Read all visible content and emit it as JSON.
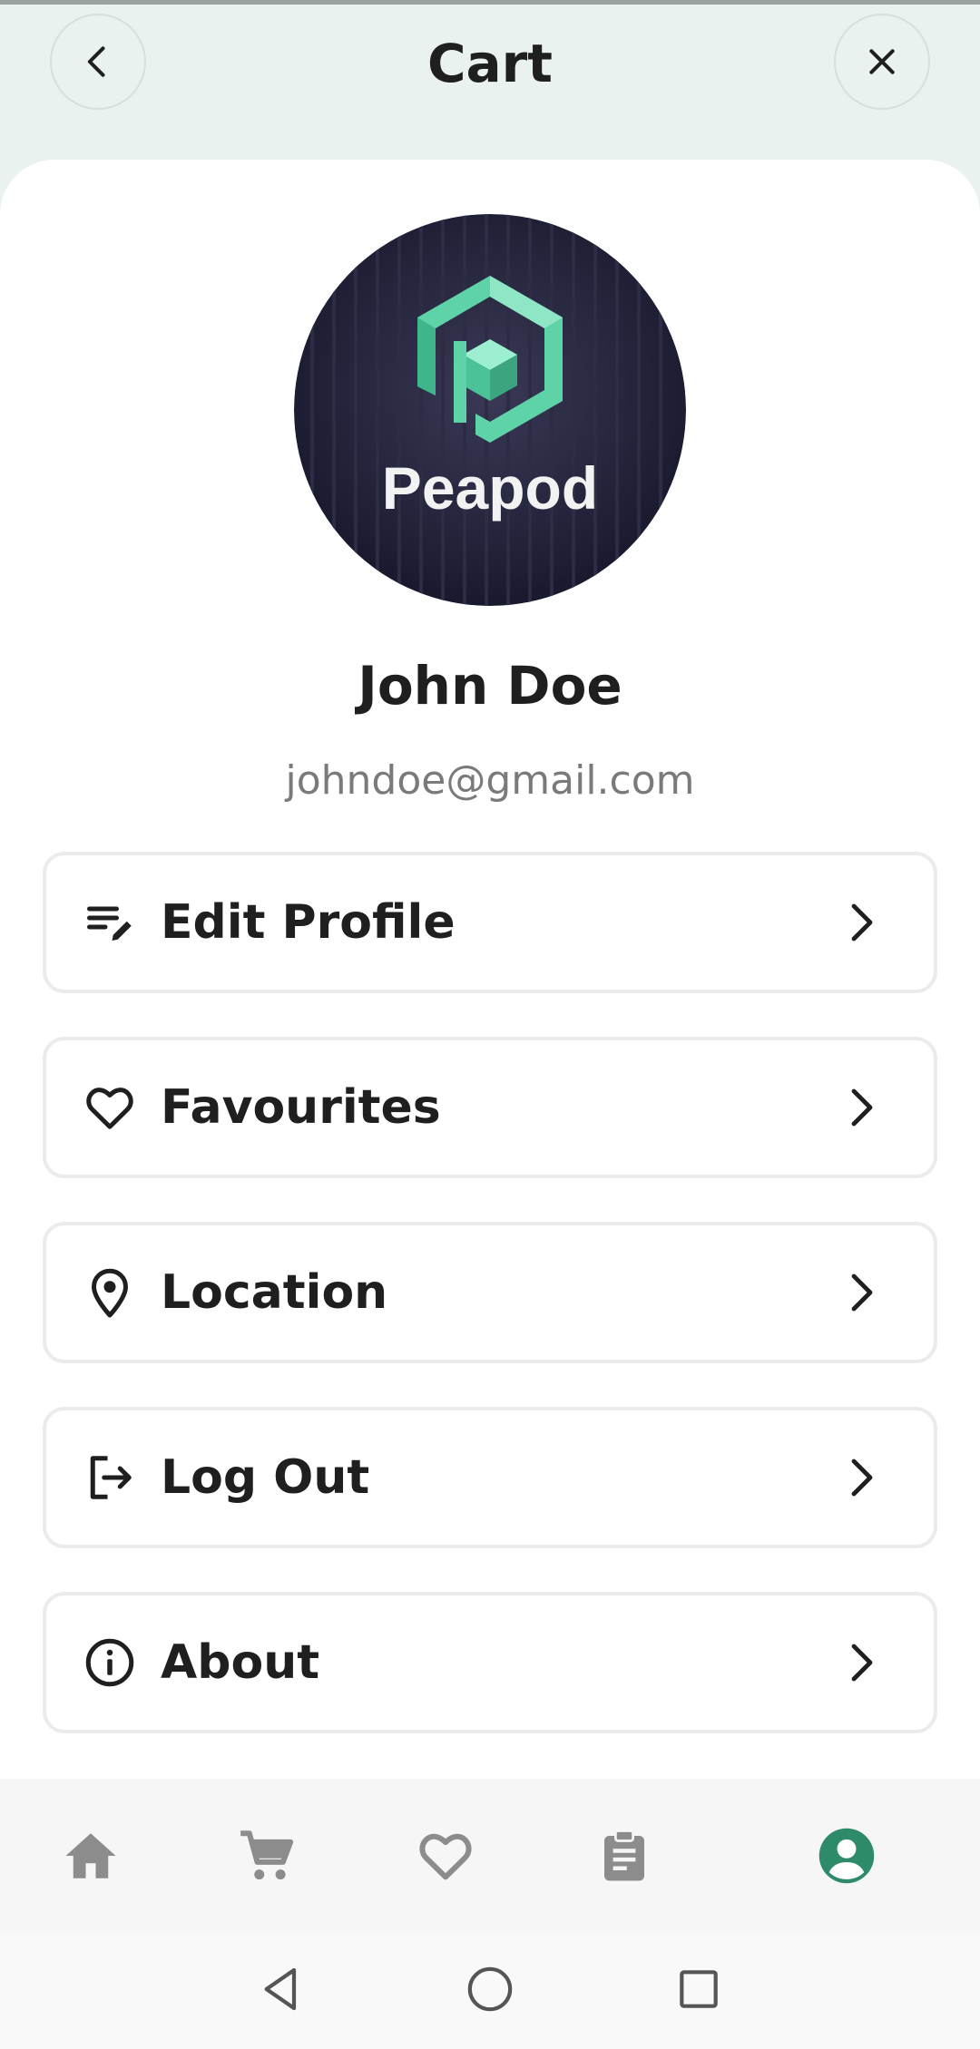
{
  "header": {
    "title": "Cart",
    "back_icon": "chevron-left-icon",
    "close_icon": "close-icon"
  },
  "profile": {
    "logo_text": "Peapod",
    "name": "John Doe",
    "email": "johndoe@gmail.com"
  },
  "menu": [
    {
      "label": "Edit Profile",
      "icon": "edit-list-icon"
    },
    {
      "label": "Favourites",
      "icon": "heart-icon"
    },
    {
      "label": "Location",
      "icon": "location-pin-icon"
    },
    {
      "label": "Log Out",
      "icon": "logout-icon"
    },
    {
      "label": "About",
      "icon": "info-icon"
    }
  ],
  "bottom_nav": {
    "items": [
      "home-icon",
      "cart-icon",
      "heart-icon",
      "clipboard-icon",
      "account-icon"
    ],
    "active": "account-icon",
    "colors": {
      "inactive": "#8c8c8c",
      "active": "#2e8b6a"
    }
  },
  "system_nav": [
    "back-triangle-icon",
    "home-circle-icon",
    "recents-square-icon"
  ],
  "colors": {
    "header_bg": "#e9f2ef",
    "accent": "#2e8b6a",
    "logo_green": "#5fd3a8",
    "logo_bg": "#24243a"
  }
}
